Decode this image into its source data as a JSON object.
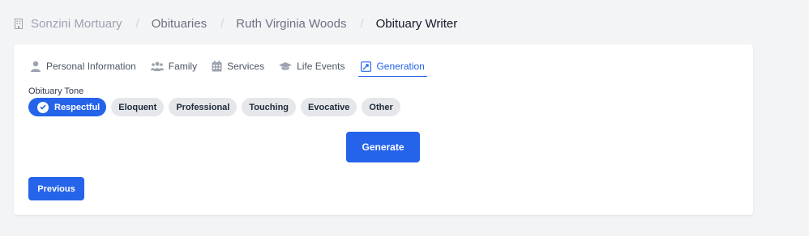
{
  "breadcrumb": {
    "items": [
      "Sonzini Mortuary",
      "Obituaries",
      "Ruth Virginia Woods",
      "Obituary Writer"
    ],
    "separator": "/"
  },
  "tabs": [
    {
      "label": "Personal Information",
      "icon": "user-icon"
    },
    {
      "label": "Family",
      "icon": "users-icon"
    },
    {
      "label": "Services",
      "icon": "calendar-icon"
    },
    {
      "label": "Life Events",
      "icon": "graduation-cap-icon"
    },
    {
      "label": "Generation",
      "icon": "generate-icon",
      "active": true
    }
  ],
  "tone": {
    "label": "Obituary Tone",
    "options": [
      "Respectful",
      "Eloquent",
      "Professional",
      "Touching",
      "Evocative",
      "Other"
    ],
    "selected": "Respectful"
  },
  "actions": {
    "generate_label": "Generate",
    "previous_label": "Previous"
  },
  "colors": {
    "accent": "#2563eb",
    "background": "#f3f4f6",
    "chip": "#e5e7eb"
  }
}
